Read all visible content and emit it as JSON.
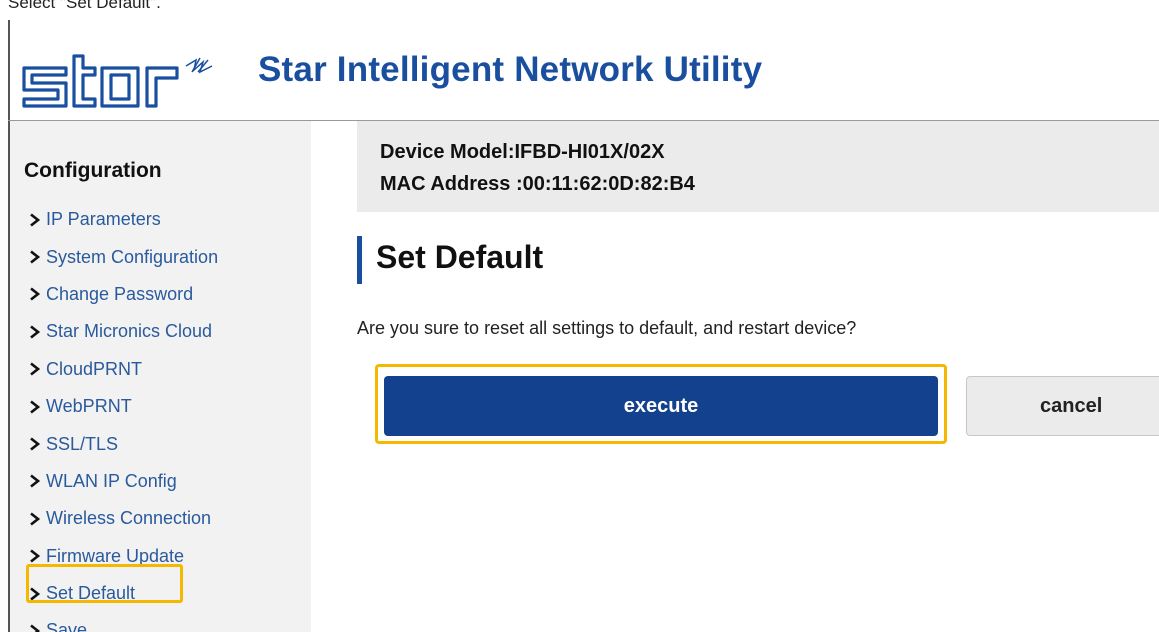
{
  "caption": "Select \"Set Default\".",
  "header": {
    "logo_text": "star",
    "title": "Star Intelligent Network Utility"
  },
  "sidebar": {
    "heading": "Configuration",
    "items": [
      {
        "label": "IP Parameters"
      },
      {
        "label": "System Configuration"
      },
      {
        "label": "Change Password"
      },
      {
        "label": "Star Micronics Cloud"
      },
      {
        "label": "CloudPRNT"
      },
      {
        "label": "WebPRNT"
      },
      {
        "label": "SSL/TLS"
      },
      {
        "label": "WLAN IP Config"
      },
      {
        "label": "Wireless Connection"
      },
      {
        "label": "Firmware Update"
      },
      {
        "label": "Set Default"
      },
      {
        "label": "Save"
      }
    ],
    "active_item": "Set Default"
  },
  "device": {
    "model_line": "Device Model:IFBD-HI01X/02X",
    "mac_line": "MAC Address :00:11:62:0D:82:B4"
  },
  "main": {
    "title": "Set Default",
    "prompt": "Are you sure to reset all settings to default, and restart device?",
    "execute_label": "execute",
    "cancel_label": "cancel"
  },
  "colors": {
    "brand_blue": "#1a4fa0",
    "execute_blue": "#13418e",
    "highlight": "#f5b800",
    "link": "#2a5a9c"
  }
}
